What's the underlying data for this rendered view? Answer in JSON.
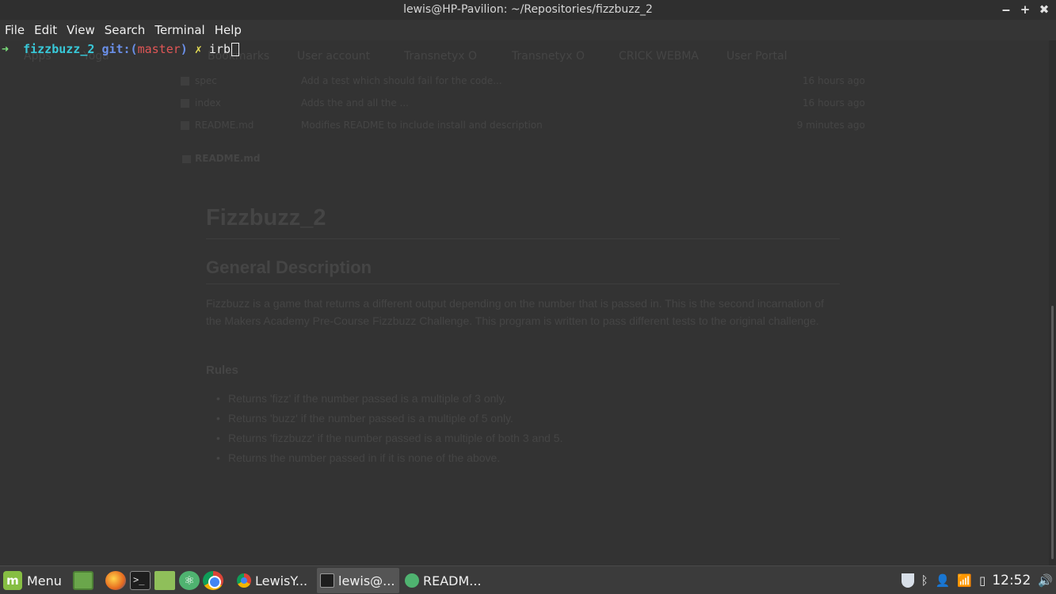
{
  "window": {
    "title": "lewis@HP-Pavilion: ~/Repositories/fizzbuzz_2",
    "minimize": "‒",
    "maximize": "+",
    "close": "✖"
  },
  "menubar": [
    "File",
    "Edit",
    "View",
    "Search",
    "Terminal",
    "Help"
  ],
  "prompt": {
    "arrow": "➜",
    "dir": "fizzbuzz_2",
    "git_label": "git:(",
    "branch": "master",
    "git_close": ")",
    "dirty": "✗",
    "command": "irb"
  },
  "background_browser": {
    "bookmarks": [
      "Apps",
      "Yoga",
      "Bookmarks",
      "User account",
      "Transnetyx O",
      "Transnetyx O",
      "CRICK WEBMA",
      "User Portal"
    ],
    "files": [
      {
        "name": "spec",
        "message": "Add a test which should fail for the code...",
        "age": "16 hours ago"
      },
      {
        "name": "index",
        "message": "Adds the and all the ...",
        "age": "16 hours ago"
      },
      {
        "name": "README.md",
        "message": "Modifies README to include install and description",
        "age": "9 minutes ago"
      }
    ],
    "readme_label": "README.md",
    "doc": {
      "h1": "Fizzbuzz_2",
      "h2": "General Description",
      "paragraph": "Fizzbuzz is a game that returns a different output depending on the number that is passed in. This is the second incarnation of the Makers Academy Pre-Course Fizzbuzz Challenge. This program is written to pass different tests to the original challenge.",
      "h3": "Rules",
      "rules": [
        "Returns 'fizz' if the number passed is a multiple of 3 only.",
        "Returns 'buzz' if the number passed is a multiple of 5 only.",
        "Returns 'fizzbuzz' if the number passed is a multiple of both 3 and 5.",
        "Returns the number passed in if it is none of the above."
      ]
    }
  },
  "taskbar": {
    "menu_label": "Menu",
    "launchers": [
      "desktop-icon",
      "firefox-icon",
      "terminal-icon",
      "files-icon",
      "atom-icon",
      "chrome-icon"
    ],
    "tasks": [
      {
        "label": "LewisY...",
        "icon": "chrome-icon"
      },
      {
        "label": "lewis@...",
        "icon": "terminal-icon"
      },
      {
        "label": "READM...",
        "icon": "atom-icon"
      }
    ],
    "clock": "12:52"
  },
  "colors": {
    "prompt_arrow": "#7be07b",
    "prompt_dir": "#38c9d9",
    "prompt_git": "#6a8fe8",
    "prompt_branch": "#e05656",
    "prompt_dirty": "#e5dd55",
    "mint_green": "#86be43"
  }
}
